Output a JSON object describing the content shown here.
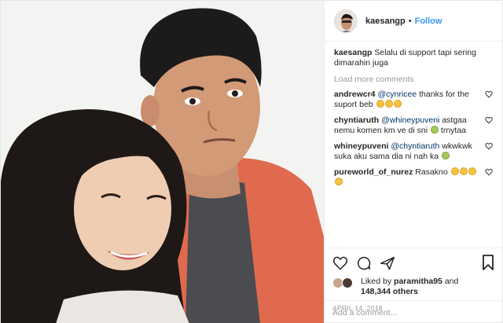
{
  "header": {
    "username": "kaesangp",
    "separator": "•",
    "follow_label": "Follow"
  },
  "caption": {
    "username": "kaesangp",
    "text": "Selalu di support tapi sering dimarahin juga"
  },
  "load_more_label": "Load more comments",
  "comments": [
    {
      "username": "andrewcr4",
      "mention": "@cynricee",
      "text": "thanks for the suport beb"
    },
    {
      "username": "chyntiaruth",
      "mention": "@whineypuveni",
      "text": "astgaa nemu komen km ve di sni",
      "tail": "trnytaa"
    },
    {
      "username": "whineypuveni",
      "mention": "@chyntiaruth",
      "text": "wkwkwk suka aku sama dia ni nah ka"
    },
    {
      "username": "pureworld_of_nurez",
      "mention": "",
      "text": "Rasakno"
    }
  ],
  "likes": {
    "prefix": "Liked by",
    "user": "paramitha95",
    "and": "and",
    "count": "148,344 others"
  },
  "date": "APRIL 14, 2018",
  "add_comment_placeholder": "Add a comment...",
  "colors": {
    "follow": "#3897f0",
    "jacket": "#e26d50",
    "shirt": "#4a4c50"
  },
  "icons": [
    "heart-icon",
    "comment-icon",
    "share-icon",
    "bookmark-icon"
  ]
}
